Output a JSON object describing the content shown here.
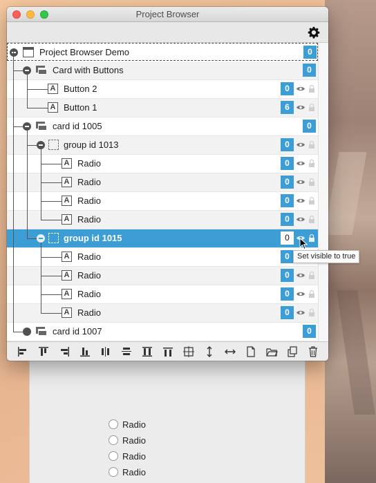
{
  "window": {
    "title": "Project Browser"
  },
  "tree": {
    "rows": [
      {
        "label": "Project Browser Demo",
        "count": "0",
        "type": "stack"
      },
      {
        "label": "Card with Buttons",
        "count": "0",
        "type": "card"
      },
      {
        "label": "Button 2",
        "count": "0",
        "type": "control"
      },
      {
        "label": "Button 1",
        "count": "6",
        "type": "control"
      },
      {
        "label": "card id 1005",
        "count": "0",
        "type": "card"
      },
      {
        "label": "group id 1013",
        "count": "0",
        "type": "group"
      },
      {
        "label": "Radio",
        "count": "0",
        "type": "control"
      },
      {
        "label": "Radio",
        "count": "0",
        "type": "control"
      },
      {
        "label": "Radio",
        "count": "0",
        "type": "control"
      },
      {
        "label": "Radio",
        "count": "0",
        "type": "control"
      },
      {
        "label": "group id 1015",
        "count": "0",
        "type": "group",
        "selected": true
      },
      {
        "label": "Radio",
        "count": "0",
        "type": "control"
      },
      {
        "label": "Radio",
        "count": "0",
        "type": "control"
      },
      {
        "label": "Radio",
        "count": "0",
        "type": "control"
      },
      {
        "label": "Radio",
        "count": "0",
        "type": "control"
      },
      {
        "label": "card id 1007",
        "count": "0",
        "type": "card"
      }
    ]
  },
  "tooltip": {
    "text": "Set visible to true"
  },
  "background_card": {
    "radios": [
      "Radio",
      "Radio",
      "Radio",
      "Radio"
    ]
  },
  "toolbar_bottom": {
    "buttons": [
      "align-left-icon",
      "align-top-icon",
      "align-right-icon",
      "align-bottom-icon",
      "distribute-horizontal-icon",
      "distribute-vertical-icon",
      "equal-height-icon",
      "equal-width-icon",
      "center-icon",
      "stretch-vertical-icon",
      "stretch-horizontal-icon",
      "new-document-icon",
      "open-folder-icon",
      "duplicate-icon",
      "trash-icon"
    ]
  },
  "colors": {
    "accent": "#3d9ed6",
    "selected_row": "#3d9ed6"
  }
}
